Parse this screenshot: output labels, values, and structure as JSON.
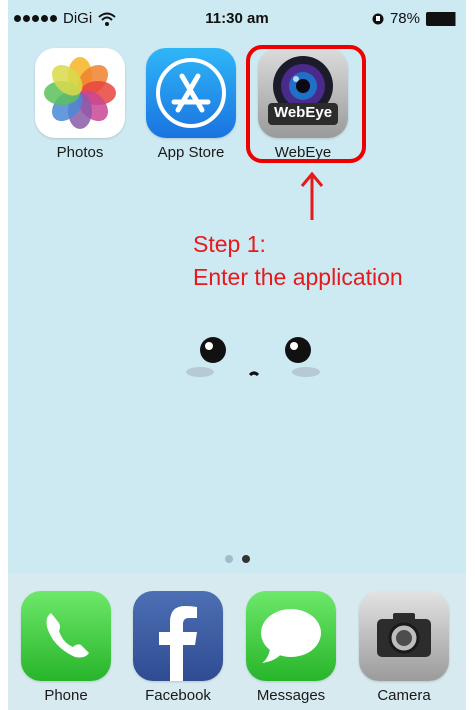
{
  "status": {
    "carrier": "DiGi",
    "time": "11:30 am",
    "battery": "78%"
  },
  "home_apps": [
    {
      "label": "Photos"
    },
    {
      "label": "App Store"
    },
    {
      "label": "WebEye",
      "icon_text": "WebEye"
    }
  ],
  "annotation": {
    "line1": "Step 1:",
    "line2": "Enter the application",
    "color": "#e8191d"
  },
  "pager": {
    "total": 2,
    "active": 2
  },
  "dock_apps": [
    {
      "label": "Phone"
    },
    {
      "label": "Facebook"
    },
    {
      "label": "Messages"
    },
    {
      "label": "Camera"
    }
  ]
}
